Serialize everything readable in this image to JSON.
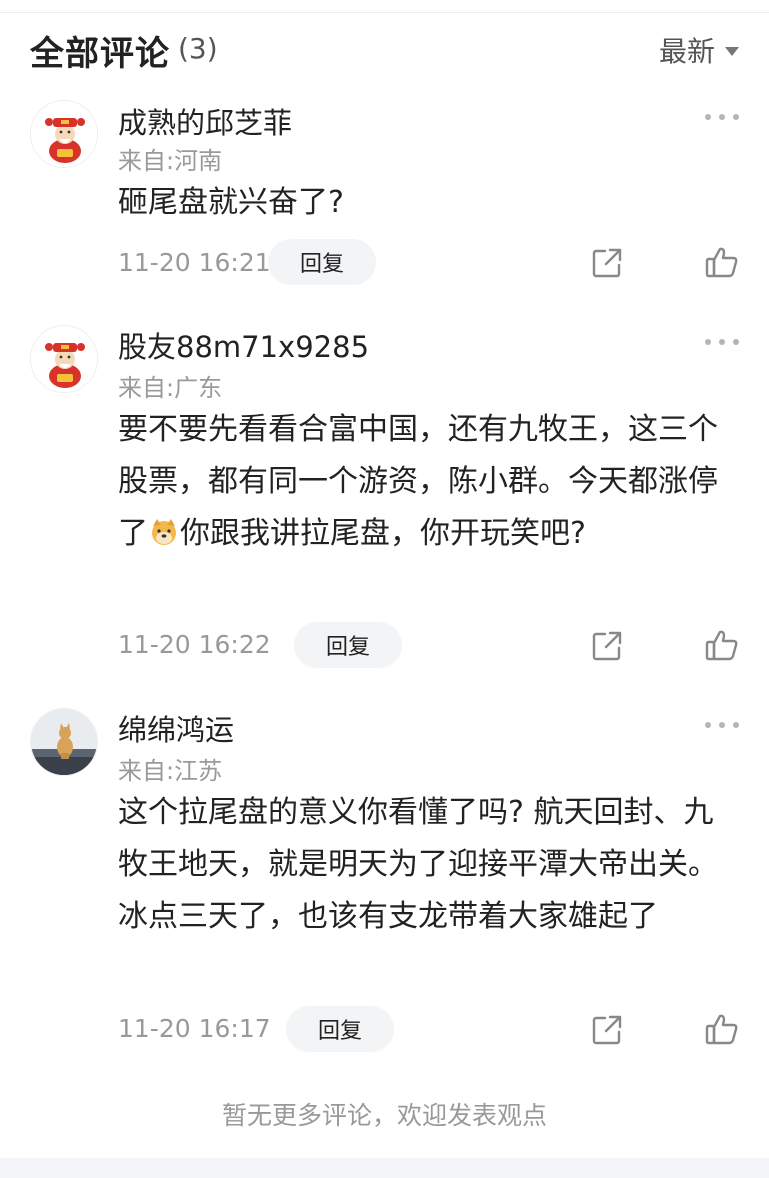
{
  "header": {
    "title": "全部评论",
    "count": "(3)",
    "sort_label": "最新"
  },
  "comments": [
    {
      "username": "成熟的邱芝菲",
      "location": "来自:河南",
      "content": "砸尾盘就兴奋了?",
      "time": "11-20 16:21",
      "reply_label": "回复",
      "avatar_icon": "caishen-avatar"
    },
    {
      "username": "股友88m71x9285",
      "location": "来自:广东",
      "content_before_emoji": "要不要先看看合富中国，还有九牧王，这三个股票，都有同一个游资，陈小群。今天都涨停了",
      "content_after_emoji": "你跟我讲拉尾盘，你开玩笑吧?",
      "emoji_icon": "doge-emoji",
      "time": "11-20 16:22",
      "reply_label": "回复",
      "avatar_icon": "caishen-avatar"
    },
    {
      "username": "绵绵鸿运",
      "location": "来自:江苏",
      "content": "这个拉尾盘的意义你看懂了吗? 航天回封、九牧王地天，就是明天为了迎接平潭大帝出关。冰点三天了，也该有支龙带着大家雄起了",
      "time": "11-20 16:17",
      "reply_label": "回复",
      "avatar_icon": "cat-photo-avatar"
    }
  ],
  "footer": {
    "note": "暂无更多评论，欢迎发表观点"
  },
  "colors": {
    "text_primary": "#222222",
    "text_secondary": "#999999",
    "reply_bg": "#f3f4f6",
    "icon": "#888888"
  }
}
